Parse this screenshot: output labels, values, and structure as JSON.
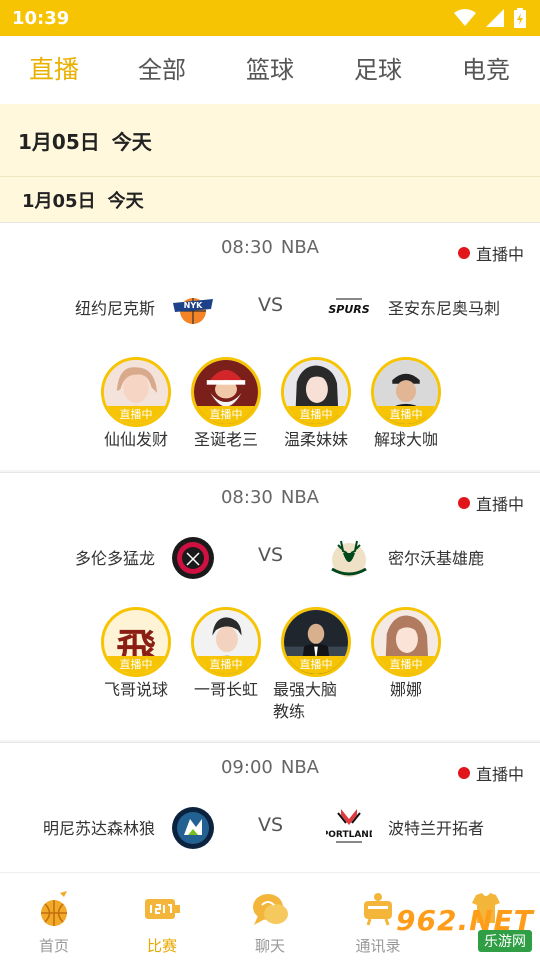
{
  "status_bar": {
    "time": "10:39"
  },
  "tabs": [
    {
      "label": "直播",
      "active": true
    },
    {
      "label": "全部",
      "active": false
    },
    {
      "label": "篮球",
      "active": false
    },
    {
      "label": "足球",
      "active": false
    },
    {
      "label": "电竞",
      "active": false
    }
  ],
  "date_header": {
    "date": "1月05日",
    "day": "今天"
  },
  "date_subheader": {
    "date": "1月05日",
    "day": "今天"
  },
  "matches": [
    {
      "time": "08:30",
      "league": "NBA",
      "status": "直播中",
      "home": {
        "name": "纽约尼克斯",
        "logo": "knicks-logo"
      },
      "vs": "VS",
      "away": {
        "name": "圣安东尼奥马刺",
        "logo": "spurs-logo"
      },
      "anchors": [
        {
          "name": "仙仙发财",
          "badge": "直播中"
        },
        {
          "name": "圣诞老三",
          "badge": "直播中"
        },
        {
          "name": "温柔妹妹",
          "badge": "直播中"
        },
        {
          "name": "解球大咖",
          "badge": "直播中"
        }
      ]
    },
    {
      "time": "08:30",
      "league": "NBA",
      "status": "直播中",
      "home": {
        "name": "多伦多猛龙",
        "logo": "raptors-logo"
      },
      "vs": "VS",
      "away": {
        "name": "密尔沃基雄鹿",
        "logo": "bucks-logo"
      },
      "anchors": [
        {
          "name": "飞哥说球",
          "badge": "直播中",
          "avatar_char": "飛"
        },
        {
          "name": "一哥长虹",
          "badge": "直播中"
        },
        {
          "name": "最强大脑教练",
          "badge": "直播中"
        },
        {
          "name": "娜娜",
          "badge": "直播中"
        }
      ]
    },
    {
      "time": "09:00",
      "league": "NBA",
      "status": "直播中",
      "home": {
        "name": "明尼苏达森林狼",
        "logo": "timberwolves-logo"
      },
      "vs": "VS",
      "away": {
        "name": "波特兰开拓者",
        "logo": "blazers-logo",
        "logo_text": "PORTLAND"
      }
    }
  ],
  "bottom_nav": [
    {
      "label": "首页",
      "icon": "home-basketball-icon",
      "active": false
    },
    {
      "label": "比赛",
      "icon": "scoreboard-icon",
      "active": true
    },
    {
      "label": "聊天",
      "icon": "chat-bubble-icon",
      "active": false
    },
    {
      "label": "通讯录",
      "icon": "contacts-icon",
      "active": false
    },
    {
      "label": "",
      "icon": "profile-jersey-icon",
      "active": false
    }
  ],
  "watermark": {
    "top": "962.NET",
    "bottom": "乐游网"
  },
  "colors": {
    "accent": "#f6c402",
    "active_text": "#eab000",
    "live_dot": "#e0161b"
  }
}
